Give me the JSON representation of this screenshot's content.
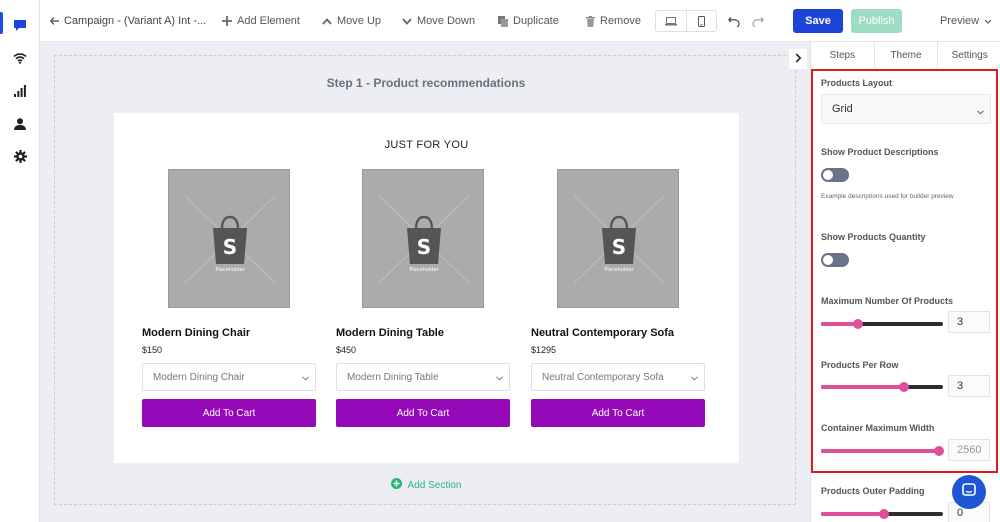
{
  "colors": {
    "primary": "#1c44d8",
    "publish": "#9fdcc4",
    "cart": "#9509b8",
    "accent_pink": "#e0509a",
    "add_section": "#2bb37a",
    "highlight": "#e01b1b"
  },
  "rail": {
    "icons": [
      "chat-icon",
      "wifi-icon",
      "bar-chart-icon",
      "user-icon",
      "gear-icon"
    ]
  },
  "toolbar": {
    "back_label": "Campaign - (Variant A) Int -...",
    "add_element": "Add Element",
    "move_up": "Move Up",
    "move_down": "Move Down",
    "duplicate": "Duplicate",
    "remove": "Remove",
    "save": "Save",
    "publish": "Publish",
    "preview": "Preview"
  },
  "canvas": {
    "step_title": "Step 1 - Product recommendations",
    "section_heading": "JUST FOR YOU",
    "placeholder_text": "Placeholder",
    "add_section": "Add Section",
    "products": [
      {
        "name": "Modern Dining Chair",
        "price": "$150",
        "option": "Modern Dining Chair",
        "cart": "Add To Cart"
      },
      {
        "name": "Modern Dining Table",
        "price": "$450",
        "option": "Modern Dining Table",
        "cart": "Add To Cart"
      },
      {
        "name": "Neutral Contemporary Sofa",
        "price": "$1295",
        "option": "Neutral Contemporary Sofa",
        "cart": "Add To Cart"
      }
    ]
  },
  "settings": {
    "tabs": [
      "Steps",
      "Theme",
      "Settings"
    ],
    "products_layout": {
      "label": "Products Layout",
      "value": "Grid"
    },
    "show_descriptions": {
      "label": "Show Product Descriptions",
      "enabled": false,
      "hint": "Example descriptions used for builder preview"
    },
    "show_quantity": {
      "label": "Show Products Quantity",
      "enabled": false
    },
    "max_products": {
      "label": "Maximum Number Of Products",
      "value": "3",
      "level": 0.3
    },
    "per_row": {
      "label": "Products Per Row",
      "value": "3",
      "level": 0.68
    },
    "container_width": {
      "label": "Container Maximum Width",
      "value": "2560",
      "level": 0.97
    },
    "outer_padding": {
      "label": "Products Outer Padding",
      "value": "0",
      "level": 0.52
    }
  }
}
